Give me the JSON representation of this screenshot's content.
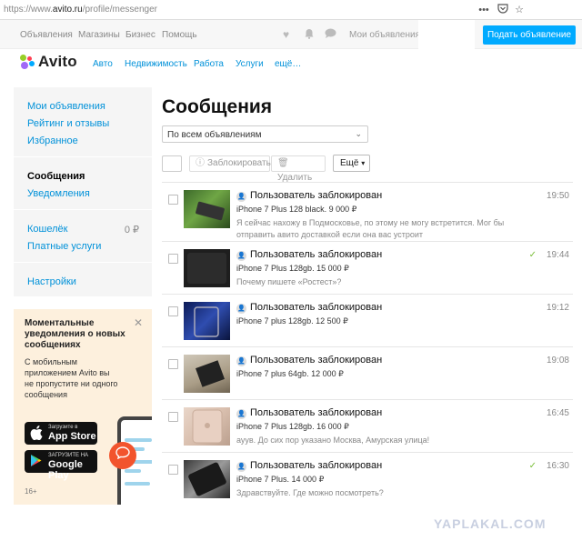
{
  "browser": {
    "url_prefix": "https://www.",
    "url_host": "avito.ru",
    "url_path": "/profile/messenger",
    "icons": [
      "ellipsis-icon",
      "pocket-icon",
      "star-icon"
    ]
  },
  "topnav": {
    "links": [
      "Объявления",
      "Магазины",
      "Бизнес",
      "Помощь"
    ],
    "my_ads": "Мои объявления",
    "post_button": "Подать объявление"
  },
  "logo": {
    "name": "Avito",
    "dot_colors": [
      "#97cf26",
      "#0af",
      "#ff4053",
      "#a169f7"
    ]
  },
  "catnav": [
    "Авто",
    "Недвижимость",
    "Работа",
    "Услуги",
    "ещё…"
  ],
  "sidebar": {
    "items": [
      {
        "label": "Мои объявления"
      },
      {
        "label": "Рейтинг и отзывы"
      },
      {
        "label": "Избранное"
      },
      {
        "label": "Сообщения"
      },
      {
        "label": "Уведомления"
      },
      {
        "label": "Кошелёк",
        "value": "0 ₽"
      },
      {
        "label": "Платные услуги"
      },
      {
        "label": "Настройки"
      }
    ]
  },
  "promo": {
    "title": "Моментальные уведомления о новых сообщениях",
    "text": "С мобильным приложением Avito вы не пропустите ни одного сообщения",
    "appstore_sub": "Загрузите в",
    "appstore_main": "App Store",
    "gplay_sub": "ЗАГРУЗИТЕ НА",
    "gplay_main": "Google Play",
    "age": "16+"
  },
  "main": {
    "title": "Сообщения",
    "filter_value": "По всем объявлениям",
    "block_button": "Заблокировать",
    "delete_button": "Удалить",
    "more_button": "Ещё"
  },
  "messages": [
    {
      "user": "Пользователь заблокирован",
      "item": "iPhone 7 Plus 128 black. 9 000 ₽",
      "text": "Я сейчас нахожу в Подмосковье, по этому не могу встретится. Мог бы отправить авито доставкой если она вас устроит",
      "time": "19:50",
      "read": false
    },
    {
      "user": "Пользователь заблокирован",
      "item": "iPhone 7 Plus 128gb. 15 000 ₽",
      "text": "Почему пишете «Ростест»?",
      "time": "19:44",
      "read": true
    },
    {
      "user": "Пользователь заблокирован",
      "item": "iPhone 7 plus 128gb. 12 500 ₽",
      "text": "",
      "time": "19:12",
      "read": false
    },
    {
      "user": "Пользователь заблокирован",
      "item": "iPhone 7 plus 64gb. 12 000 ₽",
      "text": "",
      "time": "19:08",
      "read": false
    },
    {
      "user": "Пользователь заблокирован",
      "item": "iPhone 7 Plus 128gb. 16 000 ₽",
      "text": "ауув. До сих пор указано Москва, Амурская улица!",
      "time": "16:45",
      "read": false
    },
    {
      "user": "Пользователь заблокирован",
      "item": "iPhone 7 Plus. 14 000 ₽",
      "text": "Здравствуйте. Где можно посмотреть?",
      "time": "16:30",
      "read": true
    }
  ],
  "watermark": "YAPLAKAL.COM",
  "colors": {
    "accent": "#0af",
    "link": "#0091d9",
    "read_check": "#7bbf3a",
    "promo_bg": "#fdf0dd"
  }
}
